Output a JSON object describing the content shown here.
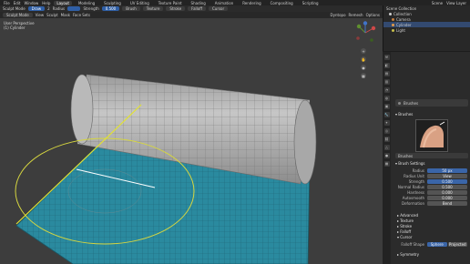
{
  "menu": {
    "items": [
      "File",
      "Edit",
      "Window",
      "Help"
    ],
    "tabs": [
      "Layout",
      "Modeling",
      "Sculpting",
      "UV Editing",
      "Texture Paint",
      "Shading",
      "Animation",
      "Rendering",
      "Compositing",
      "Scripting"
    ],
    "active_tab": "Layout",
    "scene": "Scene",
    "view_layer": "View Layer"
  },
  "header": {
    "editor_mode": "Sculpt Mode",
    "brush_name": "Draw",
    "brush_count": "2",
    "radius_label": "Radius",
    "strength_label": "Strength",
    "strength_value": "0.500",
    "options": [
      "Brush",
      "Texture",
      "Stroke",
      "Falloff",
      "Cursor"
    ]
  },
  "toolbar2": {
    "items": [
      "Sculpt Mode",
      "View",
      "Sculpt",
      "Mask",
      "Face Sets"
    ],
    "right_items": [
      "Dyntopo",
      "Remesh",
      "Options"
    ]
  },
  "viewport": {
    "overlay_title": "User Perspective",
    "overlay_object": "(1) Cylinder"
  },
  "outliner": {
    "title": "Scene Collection",
    "rows": [
      {
        "label": "Collection",
        "selected": false
      },
      {
        "label": "Camera",
        "selected": false
      },
      {
        "label": "Cylinder",
        "selected": true
      },
      {
        "label": "Light",
        "selected": false
      }
    ]
  },
  "properties": {
    "tabs": [
      "tool-icon",
      "render-icon",
      "output-icon",
      "view-layer-icon",
      "scene-icon",
      "world-icon",
      "object-icon",
      "modifier-icon",
      "particles-icon",
      "physics-icon",
      "constraints-icon",
      "data-icon",
      "material-icon",
      "texture-icon"
    ],
    "brushes_header": "Brushes",
    "brush_preview_label": "Brushes",
    "brush_name": "Brushes",
    "brush_settings": "Brush Settings",
    "rows": [
      {
        "label": "Radius",
        "value": "50 px",
        "blue": true
      },
      {
        "label": "Radius Unit",
        "value": "View",
        "blue": false
      },
      {
        "label": "Strength",
        "value": "0.500",
        "blue": true
      },
      {
        "label": "Normal Radius",
        "value": "0.500",
        "blue": false
      },
      {
        "label": "Hardness",
        "value": "0.000",
        "blue": false
      },
      {
        "label": "Autosmooth",
        "value": "0.000",
        "blue": false
      },
      {
        "label": "Deformation",
        "value": "Bend",
        "blue": false
      }
    ],
    "sections": [
      "Advanced",
      "Texture",
      "Stroke",
      "Falloff",
      "Cursor"
    ],
    "falloff_shape_label": "Falloff Shape",
    "falloff_shape_options": [
      "Sphere",
      "Projected"
    ],
    "section_symmetry": "Symmetry"
  },
  "colors": {
    "accent_blue": "#3a65a8",
    "selected_row": "#334a70",
    "mesh_plane": "#2a8a9f",
    "cursor_circle": "#d6d640"
  }
}
